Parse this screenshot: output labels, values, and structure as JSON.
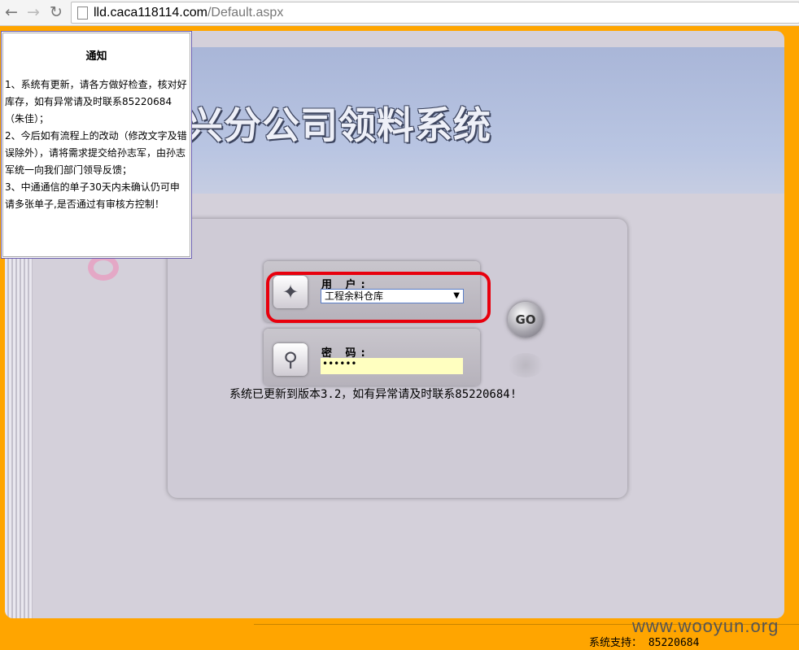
{
  "browser": {
    "url_host": "lld.caca118114.com",
    "url_path": "/Default.aspx"
  },
  "header": {
    "title": "国电信绍兴分公司领料系统"
  },
  "notice": {
    "title": "通知",
    "items": [
      "1、系统有更新，请各方做好检查，核对好库存，如有异常请及时联系85220684（朱佳）；",
      "2、今后如有流程上的改动（修改文字及错误除外），请将需求提交给孙志军，由孙志军统一向我们部门领导反馈；",
      "3、中通通信的单子30天内未确认仍可申请多张单子,是否通过有审核方控制！"
    ]
  },
  "login": {
    "user_label": "用 户:",
    "user_value": "工程余料仓库",
    "pass_label": "密 码:",
    "pass_value": "••••••",
    "go_label": "GO",
    "update_message": "系统已更新到版本3.2，如有异常请及时联系85220684!"
  },
  "footer": {
    "support": "系统支持： 85220684",
    "watermark": "www.wooyun.org"
  },
  "colors": {
    "frame": "#ffa500",
    "highlight": "#e8000d",
    "password_bg": "#ffffc0"
  },
  "icons": {
    "back": "back-arrow-icon",
    "forward": "forward-arrow-icon",
    "reload": "reload-icon",
    "user": "butterfly-icon",
    "password": "key-icon"
  }
}
